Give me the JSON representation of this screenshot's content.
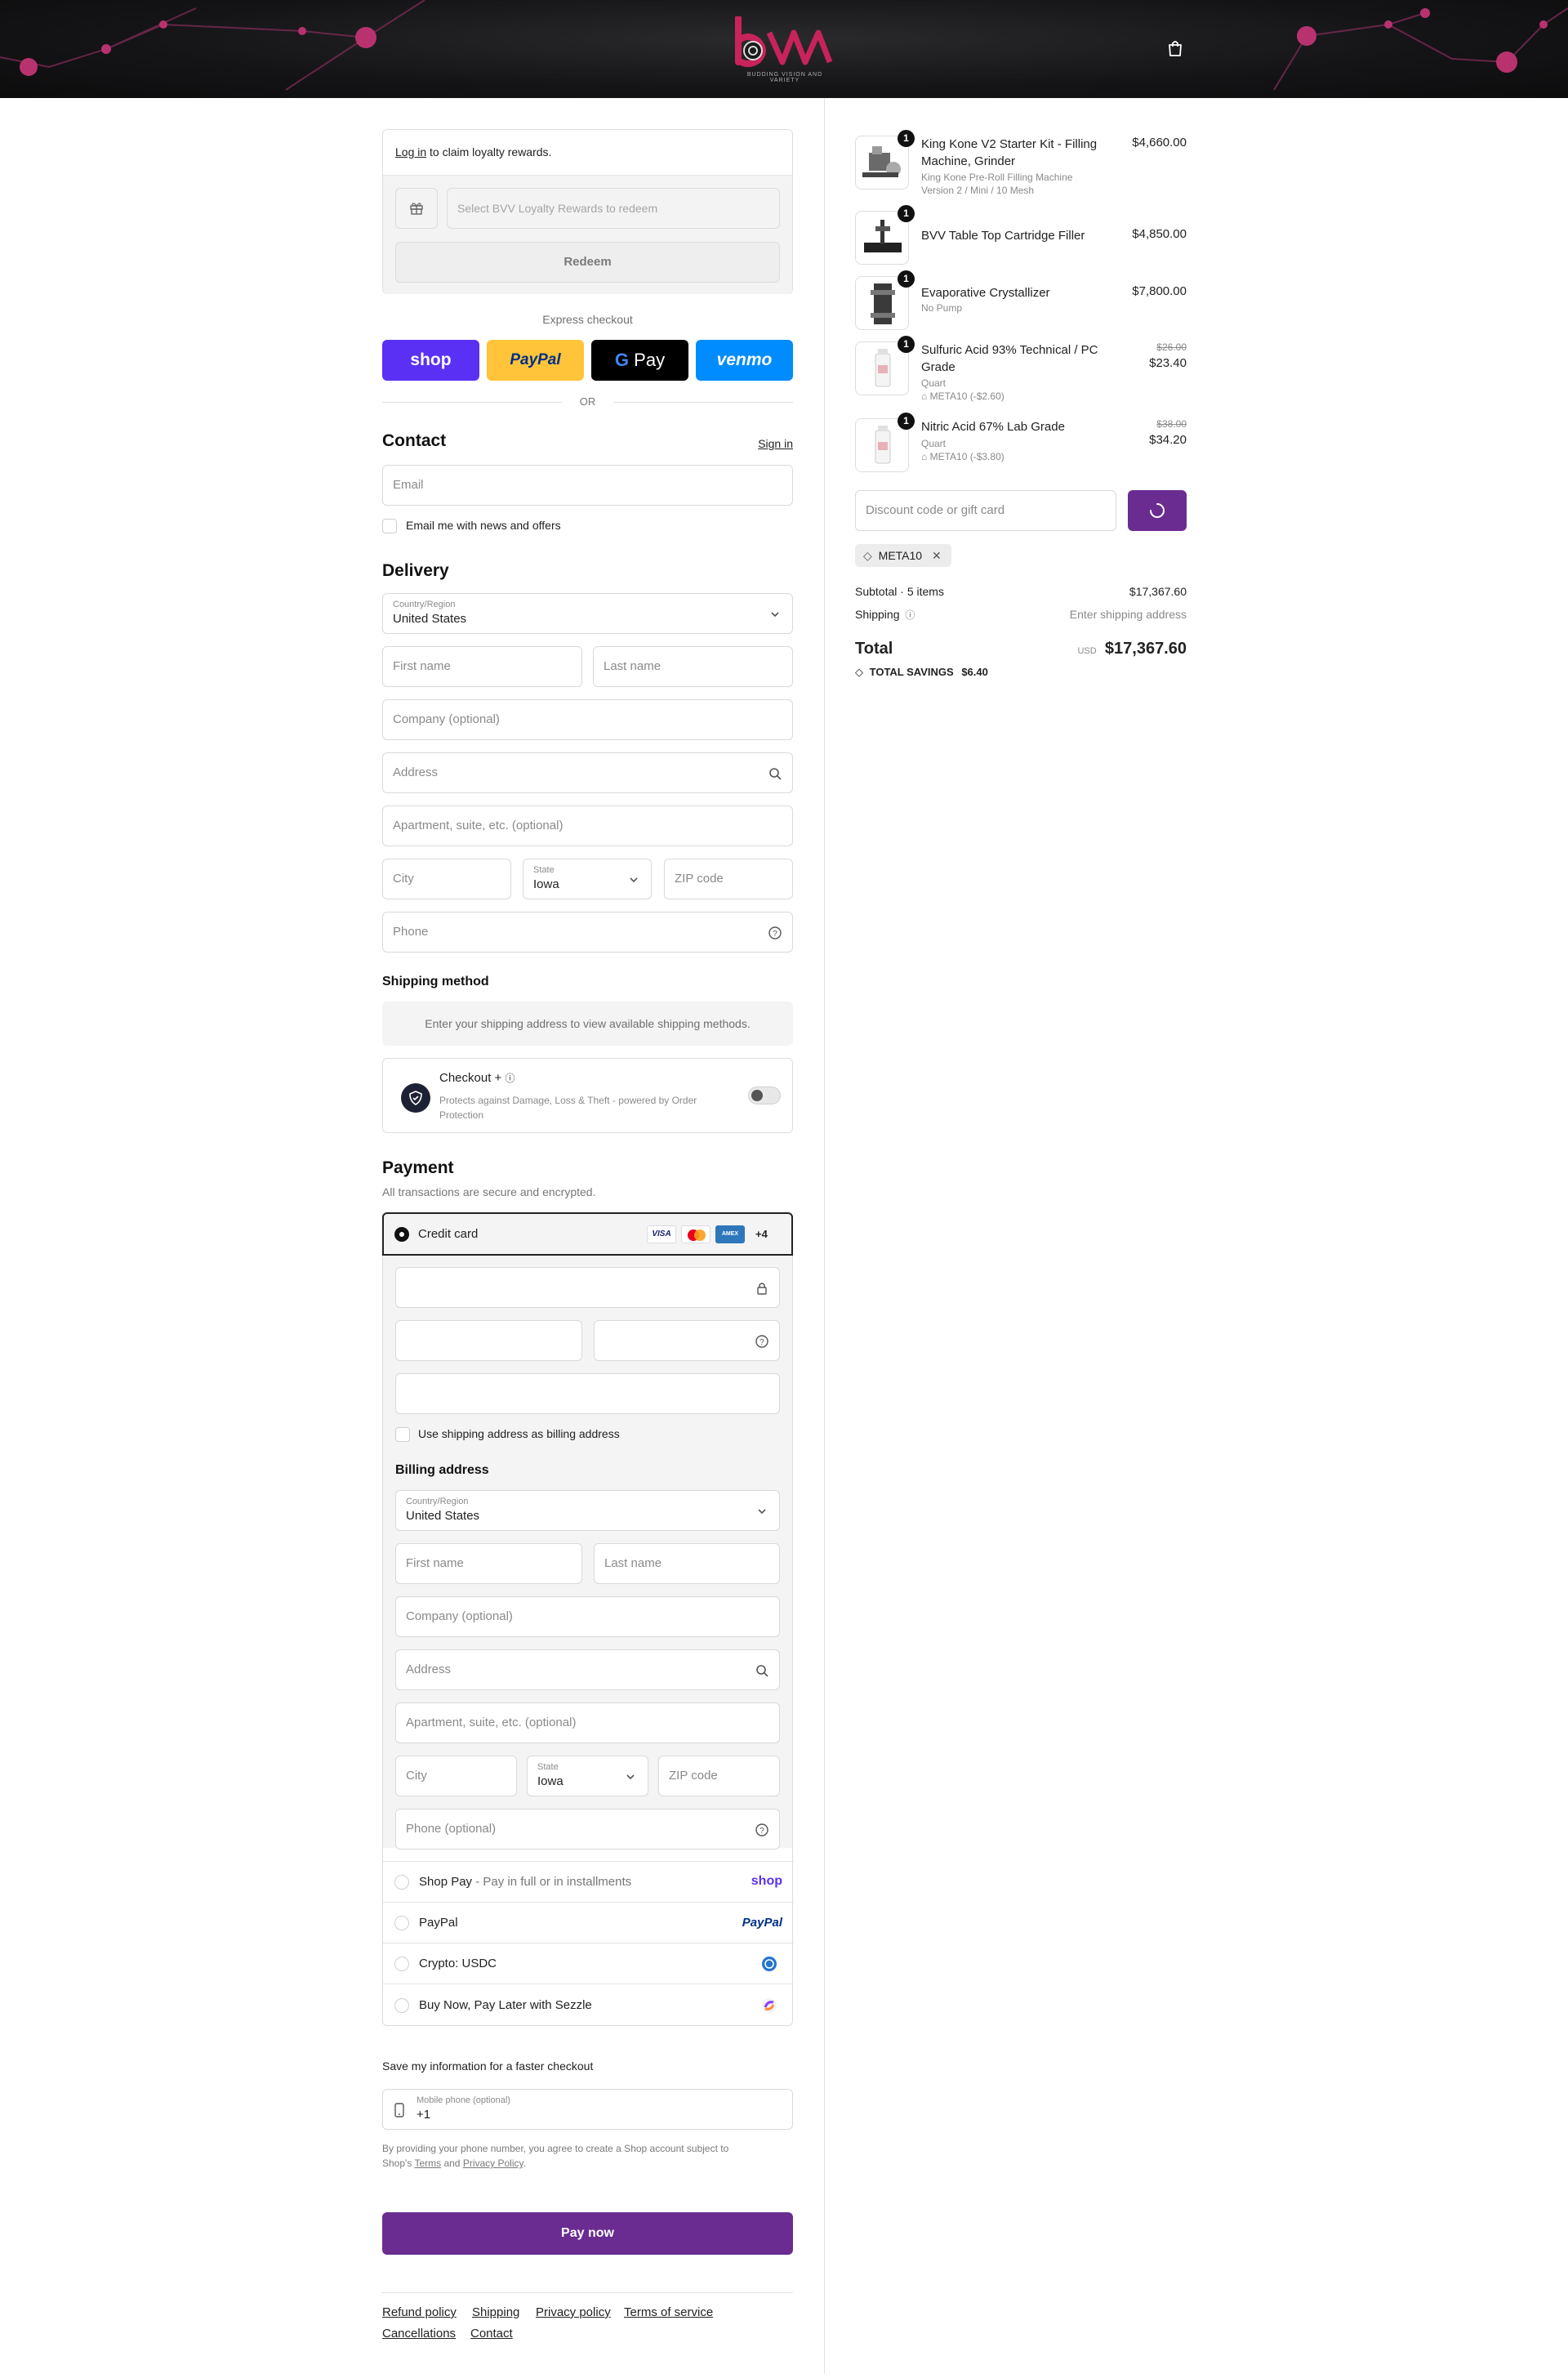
{
  "brand": {
    "tagline": "BUDDING VISION AND VARIETY",
    "accent": "#6b2c91",
    "logo_color": "#c8235a"
  },
  "loyalty": {
    "login_link": "Log in",
    "login_text": " to claim loyalty rewards.",
    "select_placeholder": "Select BVV Loyalty Rewards to redeem",
    "redeem_button": "Redeem"
  },
  "express": {
    "title": "Express checkout",
    "shop": "shop",
    "paypal": "PayPal",
    "gpay": "Pay",
    "venmo": "venmo",
    "or": "OR"
  },
  "contact": {
    "heading": "Contact",
    "sign_in": "Sign in",
    "email_placeholder": "Email",
    "news_label": "Email me with news and offers"
  },
  "delivery": {
    "heading": "Delivery",
    "country_label": "Country/Region",
    "country_value": "United States",
    "first_name": "First name",
    "last_name": "Last name",
    "company": "Company (optional)",
    "address": "Address",
    "apartment": "Apartment, suite, etc. (optional)",
    "city": "City",
    "state_label": "State",
    "state_value": "Iowa",
    "zip": "ZIP code",
    "phone": "Phone"
  },
  "shipping": {
    "heading": "Shipping method",
    "notice": "Enter your shipping address to view available shipping methods."
  },
  "protection": {
    "title": "Checkout +",
    "desc": "Protects against Damage, Loss & Theft - powered by Order Protection"
  },
  "payment": {
    "heading": "Payment",
    "subtitle": "All transactions are secure and encrypted.",
    "credit_card": "Credit card",
    "more_cards": "+4",
    "use_shipping": "Use shipping address as billing address",
    "billing_heading": "Billing address",
    "billing_country_label": "Country/Region",
    "billing_country_value": "United States",
    "billing_first": "First name",
    "billing_last": "Last name",
    "billing_company": "Company (optional)",
    "billing_address": "Address",
    "billing_apartment": "Apartment, suite, etc. (optional)",
    "billing_city": "City",
    "billing_state_label": "State",
    "billing_state_value": "Iowa",
    "billing_zip": "ZIP code",
    "billing_phone": "Phone (optional)",
    "shop_pay": "Shop Pay",
    "shop_pay_sub": " - Pay in full or in installments",
    "shop_pay_logo": "shop",
    "paypal": "PayPal",
    "paypal_logo": "PayPal",
    "crypto": "Crypto: USDC",
    "sezzle": "Buy Now, Pay Later with Sezzle"
  },
  "remember": {
    "heading": "Save my information for a faster checkout",
    "phone_label": "Mobile phone (optional)",
    "phone_value": "+1",
    "disclaimer_1": "By providing your phone number, you agree to create a Shop account subject to",
    "disclaimer_2": "Shop's ",
    "terms": "Terms",
    "and": " and ",
    "privacy": "Privacy Policy",
    "period": "."
  },
  "pay_now": "Pay now",
  "footer": {
    "refund": "Refund policy",
    "shipping": "Shipping",
    "privacy": "Privacy policy",
    "terms": "Terms of service",
    "cancellations": "Cancellations",
    "contact": "Contact"
  },
  "cart": {
    "items": [
      {
        "qty": "1",
        "name": "King Kone V2 Starter Kit - Filling Machine, Grinder",
        "variant1": "King Kone Pre-Roll Filling Machine",
        "variant2": "Version 2 / Mini / 10 Mesh",
        "price": "$4,660.00"
      },
      {
        "qty": "1",
        "name": "BVV Table Top Cartridge Filler",
        "price": "$4,850.00"
      },
      {
        "qty": "1",
        "name": "Evaporative Crystallizer",
        "variant1": "No Pump",
        "price": "$7,800.00"
      },
      {
        "qty": "1",
        "name": "Sulfuric Acid 93% Technical / PC Grade",
        "variant1": "Quart",
        "discount": "META10 (-$2.60)",
        "old_price": "$26.00",
        "price": "$23.40"
      },
      {
        "qty": "1",
        "name": "Nitric Acid 67% Lab Grade",
        "variant1": "Quart",
        "discount": "META10 (-$3.80)",
        "old_price": "$38.00",
        "price": "$34.20"
      }
    ],
    "discount_placeholder": "Discount code or gift card",
    "applied_code": "META10",
    "subtotal_label": "Subtotal · 5 items",
    "subtotal_value": "$17,367.60",
    "shipping_label": "Shipping",
    "shipping_value": "Enter shipping address",
    "total_label": "Total",
    "currency": "USD",
    "total_value": "$17,367.60",
    "savings_label": "TOTAL SAVINGS",
    "savings_value": "$6.40"
  }
}
